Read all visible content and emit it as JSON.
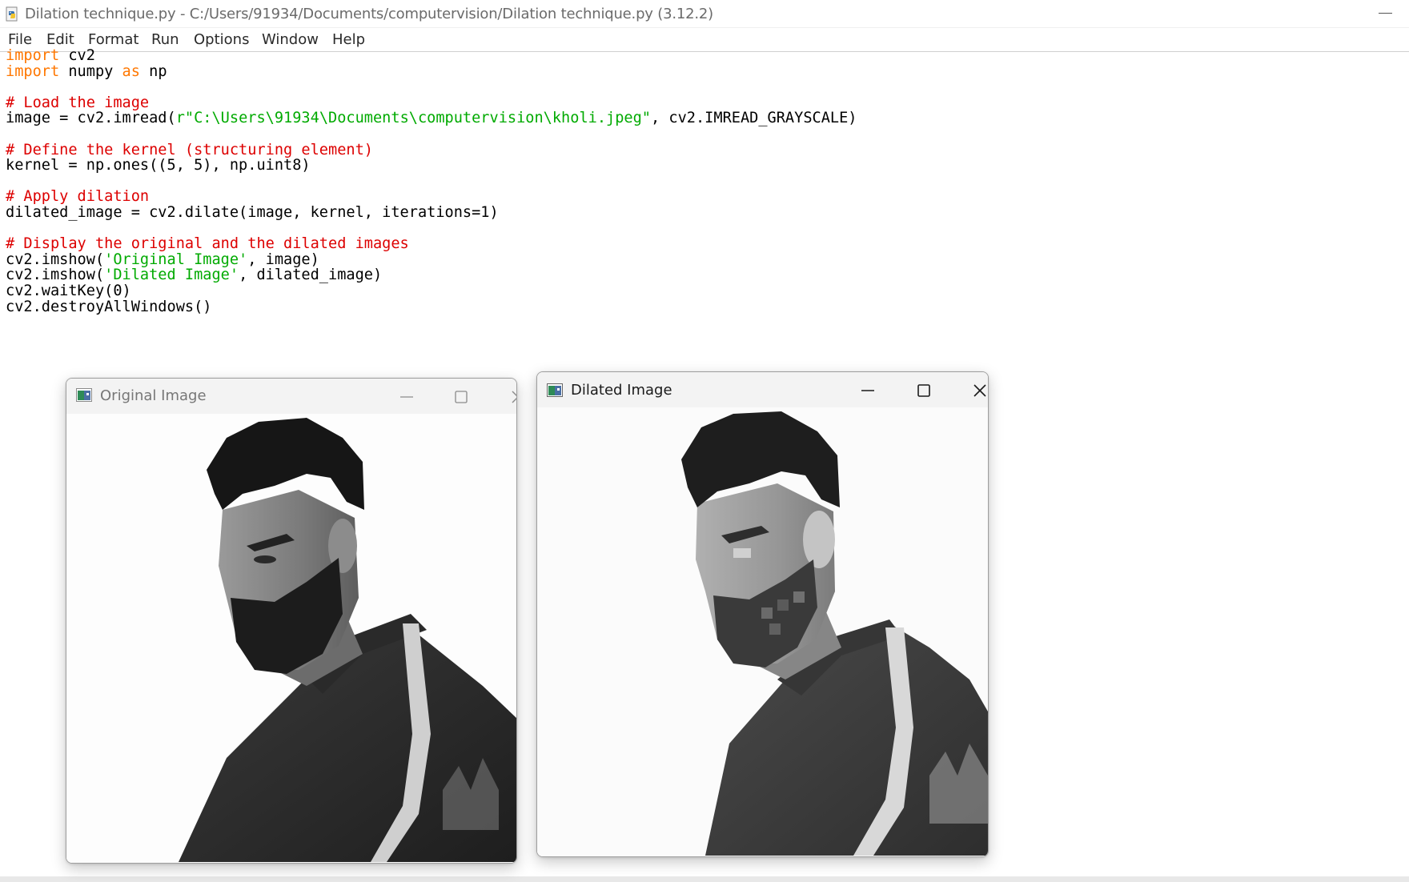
{
  "window": {
    "title": "Dilation technique.py - C:/Users/91934/Documents/computervision/Dilation technique.py (3.12.2)"
  },
  "menu": {
    "items": [
      "File",
      "Edit",
      "Format",
      "Run",
      "Options",
      "Window",
      "Help"
    ]
  },
  "code": {
    "lines": [
      [
        {
          "t": "import",
          "c": "kw"
        },
        {
          "t": " cv2",
          "c": ""
        }
      ],
      [
        {
          "t": "import",
          "c": "kw"
        },
        {
          "t": " numpy ",
          "c": ""
        },
        {
          "t": "as",
          "c": "kw"
        },
        {
          "t": " np",
          "c": ""
        }
      ],
      [],
      [
        {
          "t": "# Load the image",
          "c": "cm"
        }
      ],
      [
        {
          "t": "image = cv2.imread(",
          "c": ""
        },
        {
          "t": "r\"C:\\Users\\91934\\Documents\\computervision\\kholi.jpeg\"",
          "c": "st"
        },
        {
          "t": ", cv2.IMREAD_GRAYSCALE)",
          "c": ""
        }
      ],
      [],
      [
        {
          "t": "# Define the kernel (structuring element)",
          "c": "cm"
        }
      ],
      [
        {
          "t": "kernel = np.ones((5, 5), np.uint8)",
          "c": ""
        }
      ],
      [],
      [
        {
          "t": "# Apply dilation",
          "c": "cm"
        }
      ],
      [
        {
          "t": "dilated_image = cv2.dilate(image, kernel, iterations=1)",
          "c": ""
        }
      ],
      [],
      [
        {
          "t": "# Display the original and the dilated images",
          "c": "cm"
        }
      ],
      [
        {
          "t": "cv2.imshow(",
          "c": ""
        },
        {
          "t": "'Original Image'",
          "c": "st"
        },
        {
          "t": ", image)",
          "c": ""
        }
      ],
      [
        {
          "t": "cv2.imshow(",
          "c": ""
        },
        {
          "t": "'Dilated Image'",
          "c": "st"
        },
        {
          "t": ", dilated_image)",
          "c": ""
        }
      ],
      [
        {
          "t": "cv2.waitKey(0)",
          "c": ""
        }
      ],
      [
        {
          "t": "cv2.destroyAllWindows()",
          "c": ""
        }
      ]
    ]
  },
  "original_window": {
    "title": "Original Image",
    "state": "inactive"
  },
  "dilated_window": {
    "title": "Dilated Image",
    "state": "active"
  },
  "colors": {
    "keyword": "#ff7700",
    "comment": "#dd0000",
    "string": "#00aa00",
    "text": "#000000"
  },
  "icons": {
    "app": "python-file-icon",
    "cv_window": "opencv-window-icon",
    "minimize": "minimize-icon",
    "maximize": "maximize-icon",
    "close": "close-icon"
  }
}
